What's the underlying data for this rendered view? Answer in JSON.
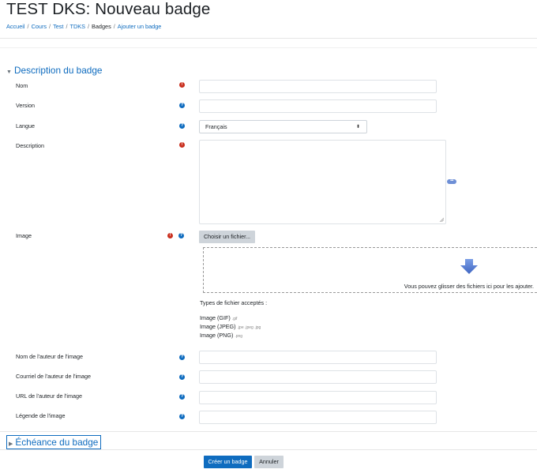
{
  "page": {
    "title": "TEST DKS: Nouveau badge"
  },
  "breadcrumb": [
    {
      "label": "Accueil",
      "link": true
    },
    {
      "label": "Cours",
      "link": true
    },
    {
      "label": "Test",
      "link": true
    },
    {
      "label": "TDKS",
      "link": true
    },
    {
      "label": "Badges",
      "link": false
    },
    {
      "label": "Ajouter un badge",
      "link": true
    }
  ],
  "breadcrumb_separator": "/",
  "sections": {
    "description": {
      "title": "Description du badge",
      "expanded": true
    },
    "deadline": {
      "title": "Échéance du badge",
      "expanded": false
    }
  },
  "fields": {
    "nom": {
      "label": "Nom",
      "icons": [
        "required-icon"
      ],
      "value": ""
    },
    "version": {
      "label": "Version",
      "icons": [
        "help-icon"
      ],
      "value": ""
    },
    "langue": {
      "label": "Langue",
      "icons": [
        "help-icon"
      ],
      "value": "Français"
    },
    "description": {
      "label": "Description",
      "icons": [
        "required-icon"
      ],
      "value": ""
    },
    "image": {
      "label": "Image",
      "icons": [
        "required-icon",
        "help-icon"
      ]
    },
    "image_author_name": {
      "label": "Nom de l'auteur de l'image",
      "icons": [
        "help-icon"
      ],
      "value": ""
    },
    "image_author_email": {
      "label": "Courriel de l'auteur de l'image",
      "icons": [
        "help-icon"
      ],
      "value": ""
    },
    "image_author_url": {
      "label": "URL de l'auteur de l'image",
      "icons": [
        "help-icon"
      ],
      "value": ""
    },
    "image_caption": {
      "label": "Légende de l'image",
      "icons": [
        "help-icon"
      ],
      "value": ""
    }
  },
  "icon_glyphs": {
    "required": "!",
    "help": "?"
  },
  "filepicker": {
    "button": "Choisir un fichier...",
    "drop_text": "Vous pouvez glisser des fichiers ici pour les ajouter.",
    "accepted_label": "Types de fichier acceptés :",
    "types": [
      {
        "name": "Image (GIF)",
        "ext": ".gif"
      },
      {
        "name": "Image (JPEG)",
        "ext": ".jpe .jpeg .jpg"
      },
      {
        "name": "Image (PNG)",
        "ext": ".png"
      }
    ]
  },
  "buttons": {
    "submit": "Créer un badge",
    "cancel": "Annuler"
  },
  "colors": {
    "link": "#0f6cbf",
    "required": "#ca3120",
    "help": "#0f6cbf",
    "primary_button": "#0f6cbf",
    "secondary_button": "#ced4da"
  }
}
